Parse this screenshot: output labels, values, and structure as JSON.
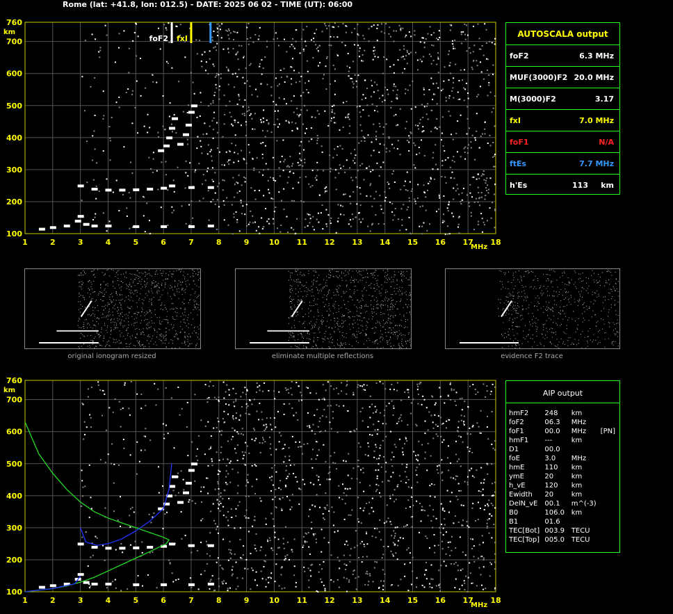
{
  "header": {
    "title": "Rome (lat: +41.8, lon: 012.5) - DATE: 2025 06 02 - TIME (UT): 06:00"
  },
  "axes": {
    "x_ticks": [
      "1",
      "2",
      "3",
      "4",
      "5",
      "6",
      "7",
      "8",
      "9",
      "10",
      "11",
      "12",
      "13",
      "14",
      "15",
      "16",
      "17",
      "18"
    ],
    "x_unit": "MHz",
    "y_ticks": [
      "100",
      "200",
      "300",
      "400",
      "500",
      "600",
      "700",
      "760"
    ],
    "y_unit": "km",
    "xlim": [
      1,
      18
    ],
    "ylim": [
      100,
      760
    ]
  },
  "markers": [
    {
      "label": "foF2",
      "freq": 6.3,
      "color": "#ffffff"
    },
    {
      "label": "fxI",
      "freq": 7.0,
      "color": "#ffff00"
    },
    {
      "label": "",
      "freq": 7.7,
      "color": "#3399ff"
    }
  ],
  "autoscala": {
    "title": "AUTOSCALA output",
    "rows": [
      {
        "name": "foF2",
        "value": "6.3 MHz",
        "color": "#ffffff"
      },
      {
        "name": "MUF(3000)F2",
        "value": "20.0 MHz",
        "color": "#ffffff"
      },
      {
        "name": "M(3000)F2",
        "value": "3.17",
        "color": "#ffffff"
      },
      {
        "name": "fxI",
        "value": "7.0 MHz",
        "color": "#ffff00"
      },
      {
        "name": "foF1",
        "value": "N/A",
        "color": "#ff2222"
      },
      {
        "name": "ftEs",
        "value": "7.7 MHz",
        "color": "#3399ff"
      },
      {
        "name": "h'Es",
        "value": "113",
        "unit": "km",
        "color": "#ffffff"
      }
    ]
  },
  "thumbnails": [
    {
      "caption": "original ionogram resized"
    },
    {
      "caption": "eliminate multiple reflections"
    },
    {
      "caption": "evidence F2 trace"
    }
  ],
  "aip": {
    "title": "AIP output",
    "rows": [
      [
        "hmF2",
        "248",
        "km",
        ""
      ],
      [
        "foF2",
        "06.3",
        "MHz",
        ""
      ],
      [
        "foF1",
        "00.0",
        "MHz",
        "[PN]"
      ],
      [
        "hmF1",
        "---",
        "km",
        ""
      ],
      [
        "D1",
        "00.0",
        "",
        ""
      ],
      [
        "foE",
        "3.0",
        "MHz",
        ""
      ],
      [
        "hmE",
        "110",
        "km",
        ""
      ],
      [
        "ymE",
        "20",
        "km",
        ""
      ],
      [
        "h_vE",
        "120",
        "km",
        ""
      ],
      [
        "Ewidth",
        "20",
        "km",
        ""
      ],
      [
        "DelN_vE",
        "00.1",
        "m^(-3)",
        ""
      ],
      [
        "B0",
        "106.0",
        "km",
        ""
      ],
      [
        "B1",
        "01.6",
        "",
        ""
      ],
      [
        "TEC[Bot]",
        "003.9",
        "TECU",
        ""
      ],
      [
        "TEC[Top]",
        "005.0",
        "TECU",
        ""
      ]
    ]
  },
  "chart_data": [
    {
      "type": "scatter",
      "title": "",
      "xlabel": "MHz",
      "ylabel": "km",
      "xlim": [
        1,
        18
      ],
      "ylim": [
        100,
        760
      ],
      "grid": true,
      "series": [
        {
          "values": [
            [
              1.6,
              115
            ],
            [
              2.0,
              120
            ],
            [
              2.5,
              125
            ],
            [
              2.9,
              140
            ],
            [
              3.0,
              155
            ],
            [
              3.2,
              130
            ],
            [
              3.5,
              125
            ],
            [
              4.0,
              125
            ],
            [
              5.0,
              123
            ],
            [
              6.0,
              123
            ],
            [
              7.0,
              123
            ],
            [
              7.7,
              125
            ]
          ]
        },
        {
          "values": [
            [
              3.0,
              250
            ],
            [
              3.5,
              240
            ],
            [
              4.0,
              237
            ],
            [
              4.5,
              237
            ],
            [
              5.0,
              238
            ],
            [
              5.5,
              240
            ],
            [
              6.0,
              243
            ],
            [
              6.3,
              250
            ],
            [
              7.0,
              245
            ],
            [
              7.7,
              245
            ]
          ]
        },
        {
          "values": [
            [
              5.9,
              360
            ],
            [
              6.1,
              375
            ],
            [
              6.2,
              400
            ],
            [
              6.3,
              430
            ],
            [
              6.4,
              460
            ],
            [
              6.6,
              380
            ],
            [
              6.8,
              410
            ],
            [
              6.9,
              440
            ],
            [
              7.0,
              480
            ],
            [
              7.1,
              500
            ]
          ]
        }
      ]
    },
    {
      "type": "line",
      "title": "",
      "xlabel": "MHz",
      "ylabel": "km",
      "xlim": [
        1,
        18
      ],
      "ylim": [
        100,
        760
      ],
      "grid": true,
      "series": [
        {
          "color": "#22dd22",
          "values": [
            [
              1.0,
              630
            ],
            [
              1.5,
              530
            ],
            [
              2.0,
              470
            ],
            [
              2.5,
              420
            ],
            [
              3.0,
              380
            ],
            [
              3.5,
              350
            ],
            [
              4.0,
              330
            ],
            [
              4.5,
              315
            ],
            [
              5.0,
              300
            ],
            [
              5.5,
              285
            ],
            [
              6.0,
              270
            ],
            [
              6.2,
              262
            ],
            [
              6.1,
              250
            ],
            [
              5.5,
              225
            ],
            [
              5.0,
              205
            ],
            [
              4.5,
              185
            ],
            [
              4.0,
              165
            ],
            [
              3.5,
              145
            ],
            [
              3.0,
              130
            ],
            [
              2.5,
              118
            ],
            [
              2.0,
              110
            ],
            [
              1.0,
              100
            ]
          ]
        },
        {
          "color": "#2233ff",
          "values": [
            [
              3.0,
              300
            ],
            [
              3.2,
              255
            ],
            [
              3.6,
              245
            ],
            [
              4.0,
              250
            ],
            [
              4.5,
              265
            ],
            [
              5.0,
              290
            ],
            [
              5.5,
              320
            ],
            [
              6.0,
              360
            ],
            [
              6.2,
              420
            ],
            [
              6.3,
              500
            ]
          ]
        },
        {
          "color": "#2233ff",
          "values": [
            [
              1.0,
              100
            ],
            [
              2.0,
              110
            ],
            [
              2.8,
              125
            ],
            [
              3.0,
              150
            ]
          ]
        }
      ]
    }
  ]
}
